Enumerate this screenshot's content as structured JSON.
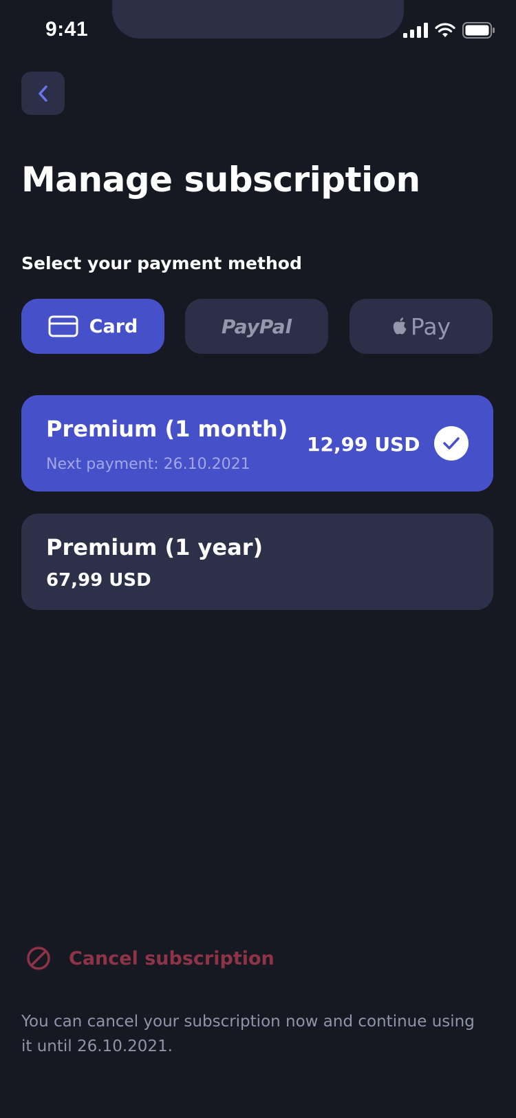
{
  "status_bar": {
    "time": "9:41"
  },
  "header": {
    "back_icon": "chevron-left-icon",
    "title": "Manage subscription"
  },
  "payment": {
    "label": "Select your payment method",
    "methods": [
      {
        "label": "Card",
        "icon": "credit-card-icon",
        "selected": true
      },
      {
        "label": "PayPal",
        "selected": false
      },
      {
        "label": "Pay",
        "icon": "apple-icon",
        "selected": false
      }
    ]
  },
  "plans": [
    {
      "name": "Premium (1 month)",
      "next_payment": "Next payment: 26.10.2021",
      "price": "12,99 USD",
      "selected": true
    },
    {
      "name": "Premium (1 year)",
      "price": "67,99 USD",
      "selected": false
    }
  ],
  "cancel": {
    "label": "Cancel subscription",
    "icon": "prohibited-icon",
    "note": "You can cancel your subscription now and continue using it until 26.10.2021."
  },
  "colors": {
    "background": "#161822",
    "accent": "#4550c9",
    "surface": "#2c2f47",
    "danger": "#8e3446",
    "muted_text": "#9194a8"
  }
}
